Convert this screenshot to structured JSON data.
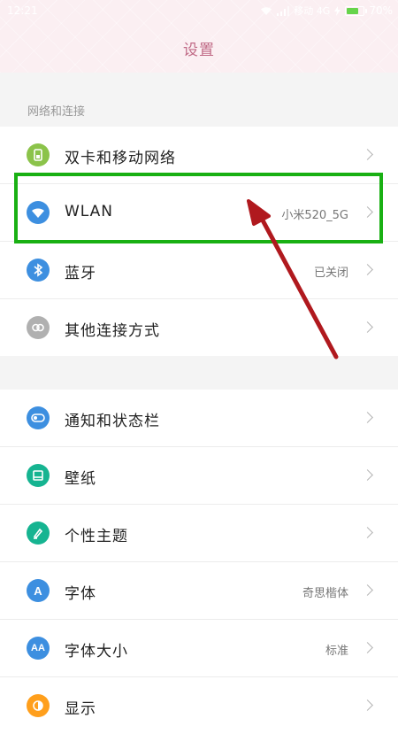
{
  "status_bar": {
    "time": "12:21",
    "carrier": "移动 4G",
    "battery": "70%",
    "battery_level": 0.7
  },
  "header": {
    "title": "设置"
  },
  "sections": [
    {
      "title": "网络和连接",
      "items": [
        {
          "label": "双卡和移动网络",
          "value": "",
          "icon": "sim-card-icon",
          "color": "#8bc34a"
        },
        {
          "label": "WLAN",
          "value": "小米520_5G",
          "icon": "wifi-icon",
          "color": "#3d8fe0"
        },
        {
          "label": "蓝牙",
          "value": "已关闭",
          "icon": "bluetooth-icon",
          "color": "#3d8fe0"
        },
        {
          "label": "其他连接方式",
          "value": "",
          "icon": "link-icon",
          "color": "#b0b0b0"
        }
      ]
    },
    {
      "title": "",
      "items": [
        {
          "label": "通知和状态栏",
          "value": "",
          "icon": "toggle-icon",
          "color": "#3d8fe0"
        },
        {
          "label": "壁纸",
          "value": "",
          "icon": "wallpaper-icon",
          "color": "#16b491"
        },
        {
          "label": "个性主题",
          "value": "",
          "icon": "brush-icon",
          "color": "#16b491"
        },
        {
          "label": "字体",
          "value": "奇思楷体",
          "icon": "font-icon",
          "color": "#3d8fe0",
          "glyph": "A"
        },
        {
          "label": "字体大小",
          "value": "标准",
          "icon": "font-size-icon",
          "color": "#3d8fe0",
          "glyph": "AA"
        },
        {
          "label": "显示",
          "value": "",
          "icon": "display-icon",
          "color": "#ff9f1c"
        }
      ]
    }
  ],
  "colors": {
    "highlight": "#19b013",
    "arrow": "#b0191e",
    "title": "#c06a86"
  }
}
